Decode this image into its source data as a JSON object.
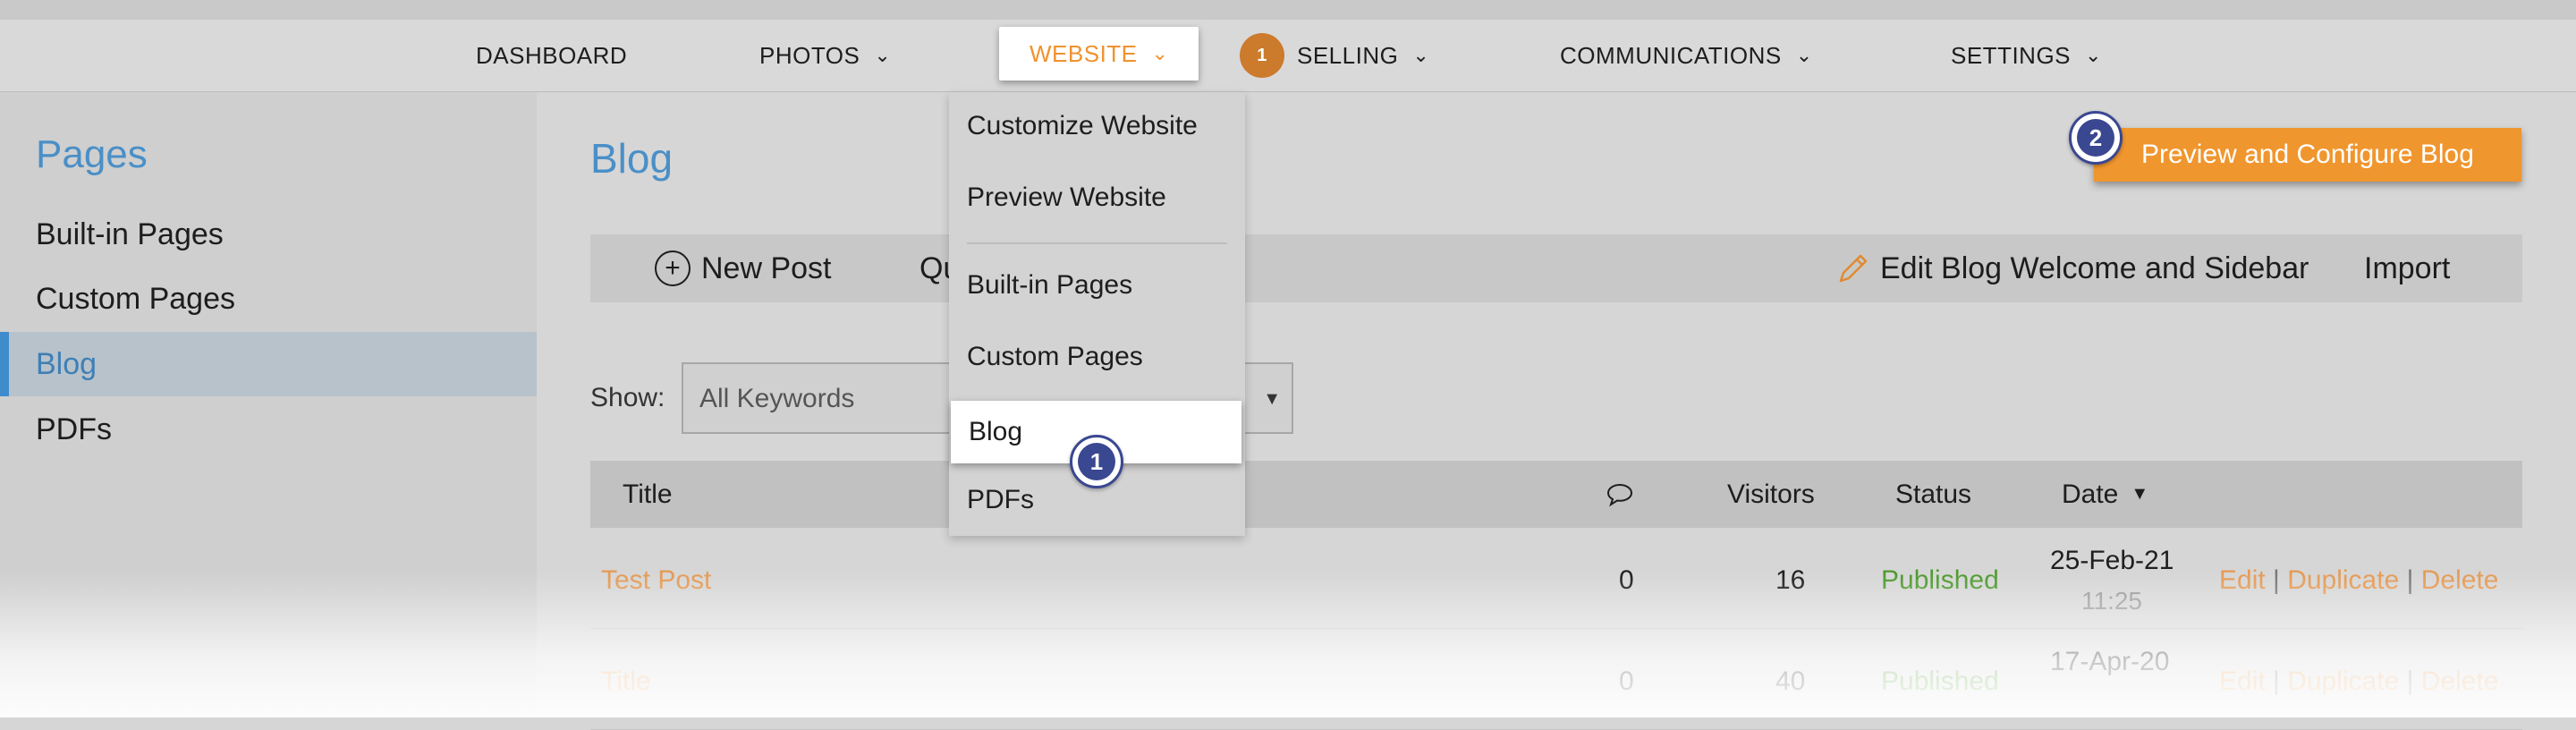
{
  "nav": {
    "items": [
      {
        "label": "DASHBOARD"
      },
      {
        "label": "PHOTOS"
      },
      {
        "label": "WEBSITE"
      },
      {
        "label": "SELLING",
        "badge": "1"
      },
      {
        "label": "COMMUNICATIONS"
      },
      {
        "label": "SETTINGS"
      }
    ]
  },
  "sidebar": {
    "title": "Pages",
    "items": [
      {
        "label": "Built-in Pages"
      },
      {
        "label": "Custom Pages"
      },
      {
        "label": "Blog",
        "active": true
      },
      {
        "label": "PDFs"
      }
    ]
  },
  "website_menu": {
    "items": [
      {
        "label": "Customize Website"
      },
      {
        "label": "Preview Website"
      },
      {
        "label": "Built-in Pages"
      },
      {
        "label": "Custom Pages"
      },
      {
        "label": "Blog",
        "active": true
      },
      {
        "label": "PDFs"
      }
    ]
  },
  "main": {
    "title": "Blog",
    "preview_button": "Preview and Configure Blog",
    "toolbar": {
      "new_post": "New Post",
      "quick_partial": "Qu",
      "edit_welcome": "Edit Blog Welcome and Sidebar",
      "import": "Import"
    },
    "filter": {
      "label": "Show:",
      "value": "All Keywords"
    },
    "table": {
      "headers": {
        "title": "Title",
        "visitors": "Visitors",
        "status": "Status",
        "date": "Date"
      },
      "rows": [
        {
          "title": "Test Post",
          "comments": "0",
          "visitors": "16",
          "status": "Published",
          "date": "25-Feb-21",
          "time": "11:25",
          "edit": "Edit",
          "duplicate": "Duplicate",
          "delete": "Delete"
        },
        {
          "title": "Title",
          "comments": "0",
          "visitors": "40",
          "status": "Published",
          "date": "17-Apr-20",
          "time": "",
          "edit": "Edit",
          "duplicate": "Duplicate",
          "delete": "Delete"
        }
      ]
    }
  },
  "steps": {
    "one": "1",
    "two": "2"
  },
  "colors": {
    "accent_orange": "#f0962e",
    "link_blue": "#4a8fc7",
    "step_navy": "#3a4791",
    "published_green": "#4e9a2e"
  }
}
